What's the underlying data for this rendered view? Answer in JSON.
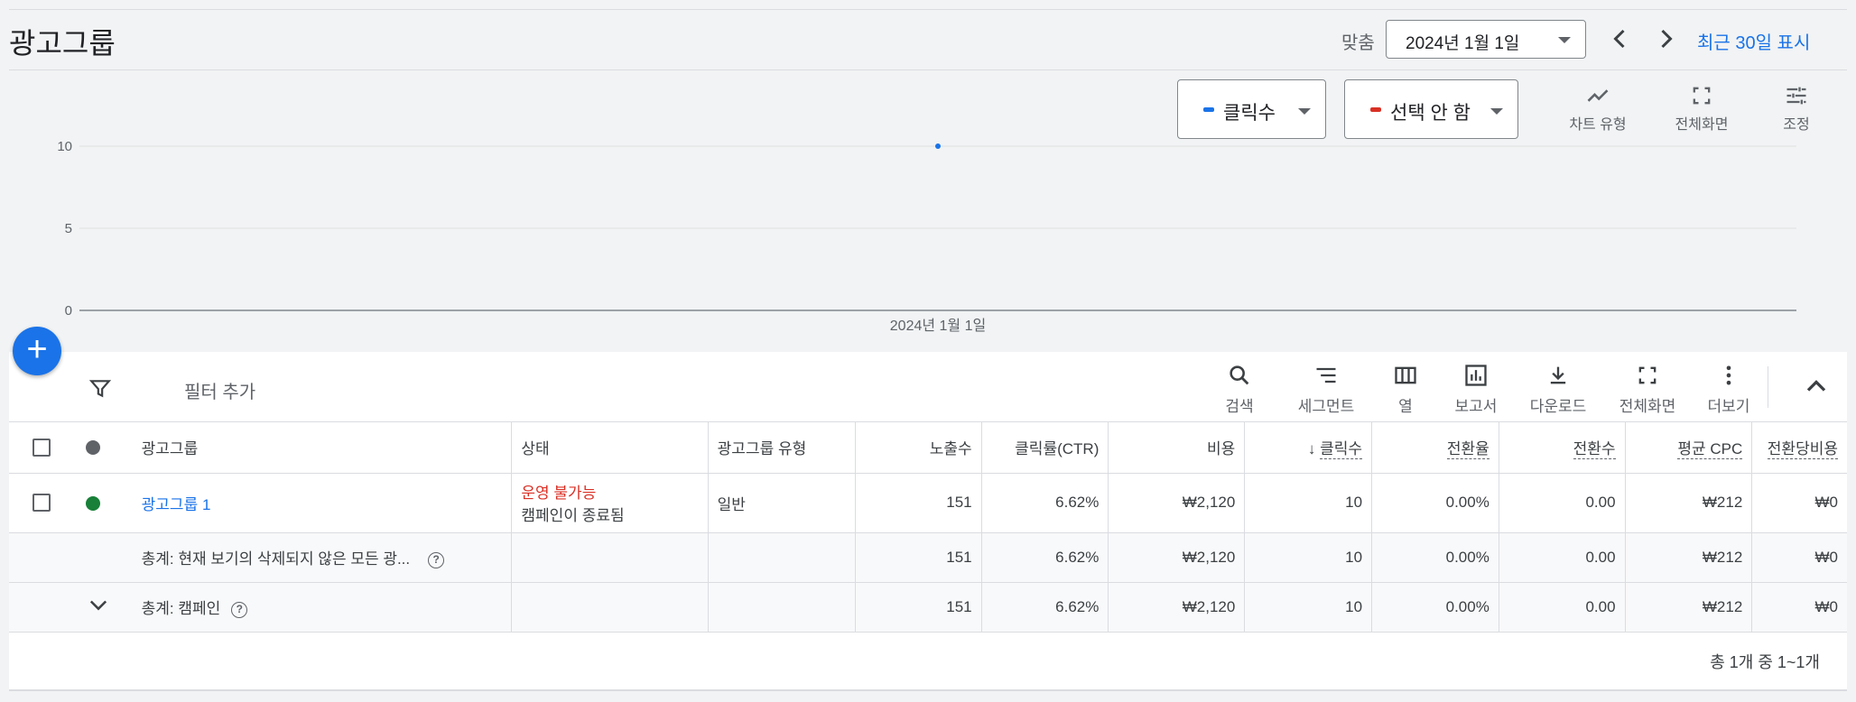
{
  "header": {
    "title": "광고그룹",
    "fit_label": "맞춤",
    "date_value": "2024년 1월 1일",
    "show_recent": "최근 30일 표시"
  },
  "chart_controls": {
    "metric1": {
      "label": "클릭수",
      "color": "#1a73e8"
    },
    "metric2": {
      "label": "선택 안 함",
      "color": "#d93025"
    },
    "tools": [
      {
        "label": "차트 유형",
        "icon": "line-chart-icon"
      },
      {
        "label": "전체화면",
        "icon": "fullscreen-icon"
      },
      {
        "label": "조정",
        "icon": "tune-icon"
      }
    ]
  },
  "chart_data": {
    "type": "line",
    "x": [
      "2024년 1월 1일"
    ],
    "series": [
      {
        "name": "클릭수",
        "values": [
          10
        ],
        "color": "#1a73e8"
      }
    ],
    "yticks": [
      0,
      5,
      10
    ],
    "ylim": [
      0,
      10
    ],
    "grid": true
  },
  "toolbar": {
    "filter_text": "필터 추가",
    "buttons": [
      {
        "label": "검색",
        "icon": "search-icon"
      },
      {
        "label": "세그먼트",
        "icon": "segment-icon"
      },
      {
        "label": "열",
        "icon": "columns-icon"
      },
      {
        "label": "보고서",
        "icon": "report-icon"
      },
      {
        "label": "다운로드",
        "icon": "download-icon"
      },
      {
        "label": "전체화면",
        "icon": "fullscreen-icon"
      },
      {
        "label": "더보기",
        "icon": "more-vert-icon"
      }
    ]
  },
  "table": {
    "headers": {
      "adgroup": "광고그룹",
      "status": "상태",
      "type": "광고그룹 유형",
      "impressions": "노출수",
      "ctr": "클릭률(CTR)",
      "cost": "비용",
      "clicks": "클릭수",
      "conv_rate": "전환율",
      "conversions": "전환수",
      "avg_cpc": "평균 CPC",
      "cost_per_conv": "전환당비용"
    },
    "row": {
      "name": "광고그룹 1",
      "status": "운영 불가능",
      "status_sub": "캠페인이 종료됨",
      "type": "일반",
      "impressions": "151",
      "ctr": "6.62%",
      "cost": "₩2,120",
      "clicks": "10",
      "conv_rate": "0.00%",
      "conversions": "0.00",
      "avg_cpc": "₩212",
      "cost_per_conv": "₩0"
    },
    "total1": {
      "label": "총계: 현재 보기의 삭제되지 않은 모든 광...",
      "impressions": "151",
      "ctr": "6.62%",
      "cost": "₩2,120",
      "clicks": "10",
      "conv_rate": "0.00%",
      "conversions": "0.00",
      "avg_cpc": "₩212",
      "cost_per_conv": "₩0"
    },
    "total2": {
      "label": "총계: 캠페인",
      "impressions": "151",
      "ctr": "6.62%",
      "cost": "₩2,120",
      "clicks": "10",
      "conv_rate": "0.00%",
      "conversions": "0.00",
      "avg_cpc": "₩212",
      "cost_per_conv": "₩0"
    },
    "pagination": "총 1개 중 1~1개"
  }
}
